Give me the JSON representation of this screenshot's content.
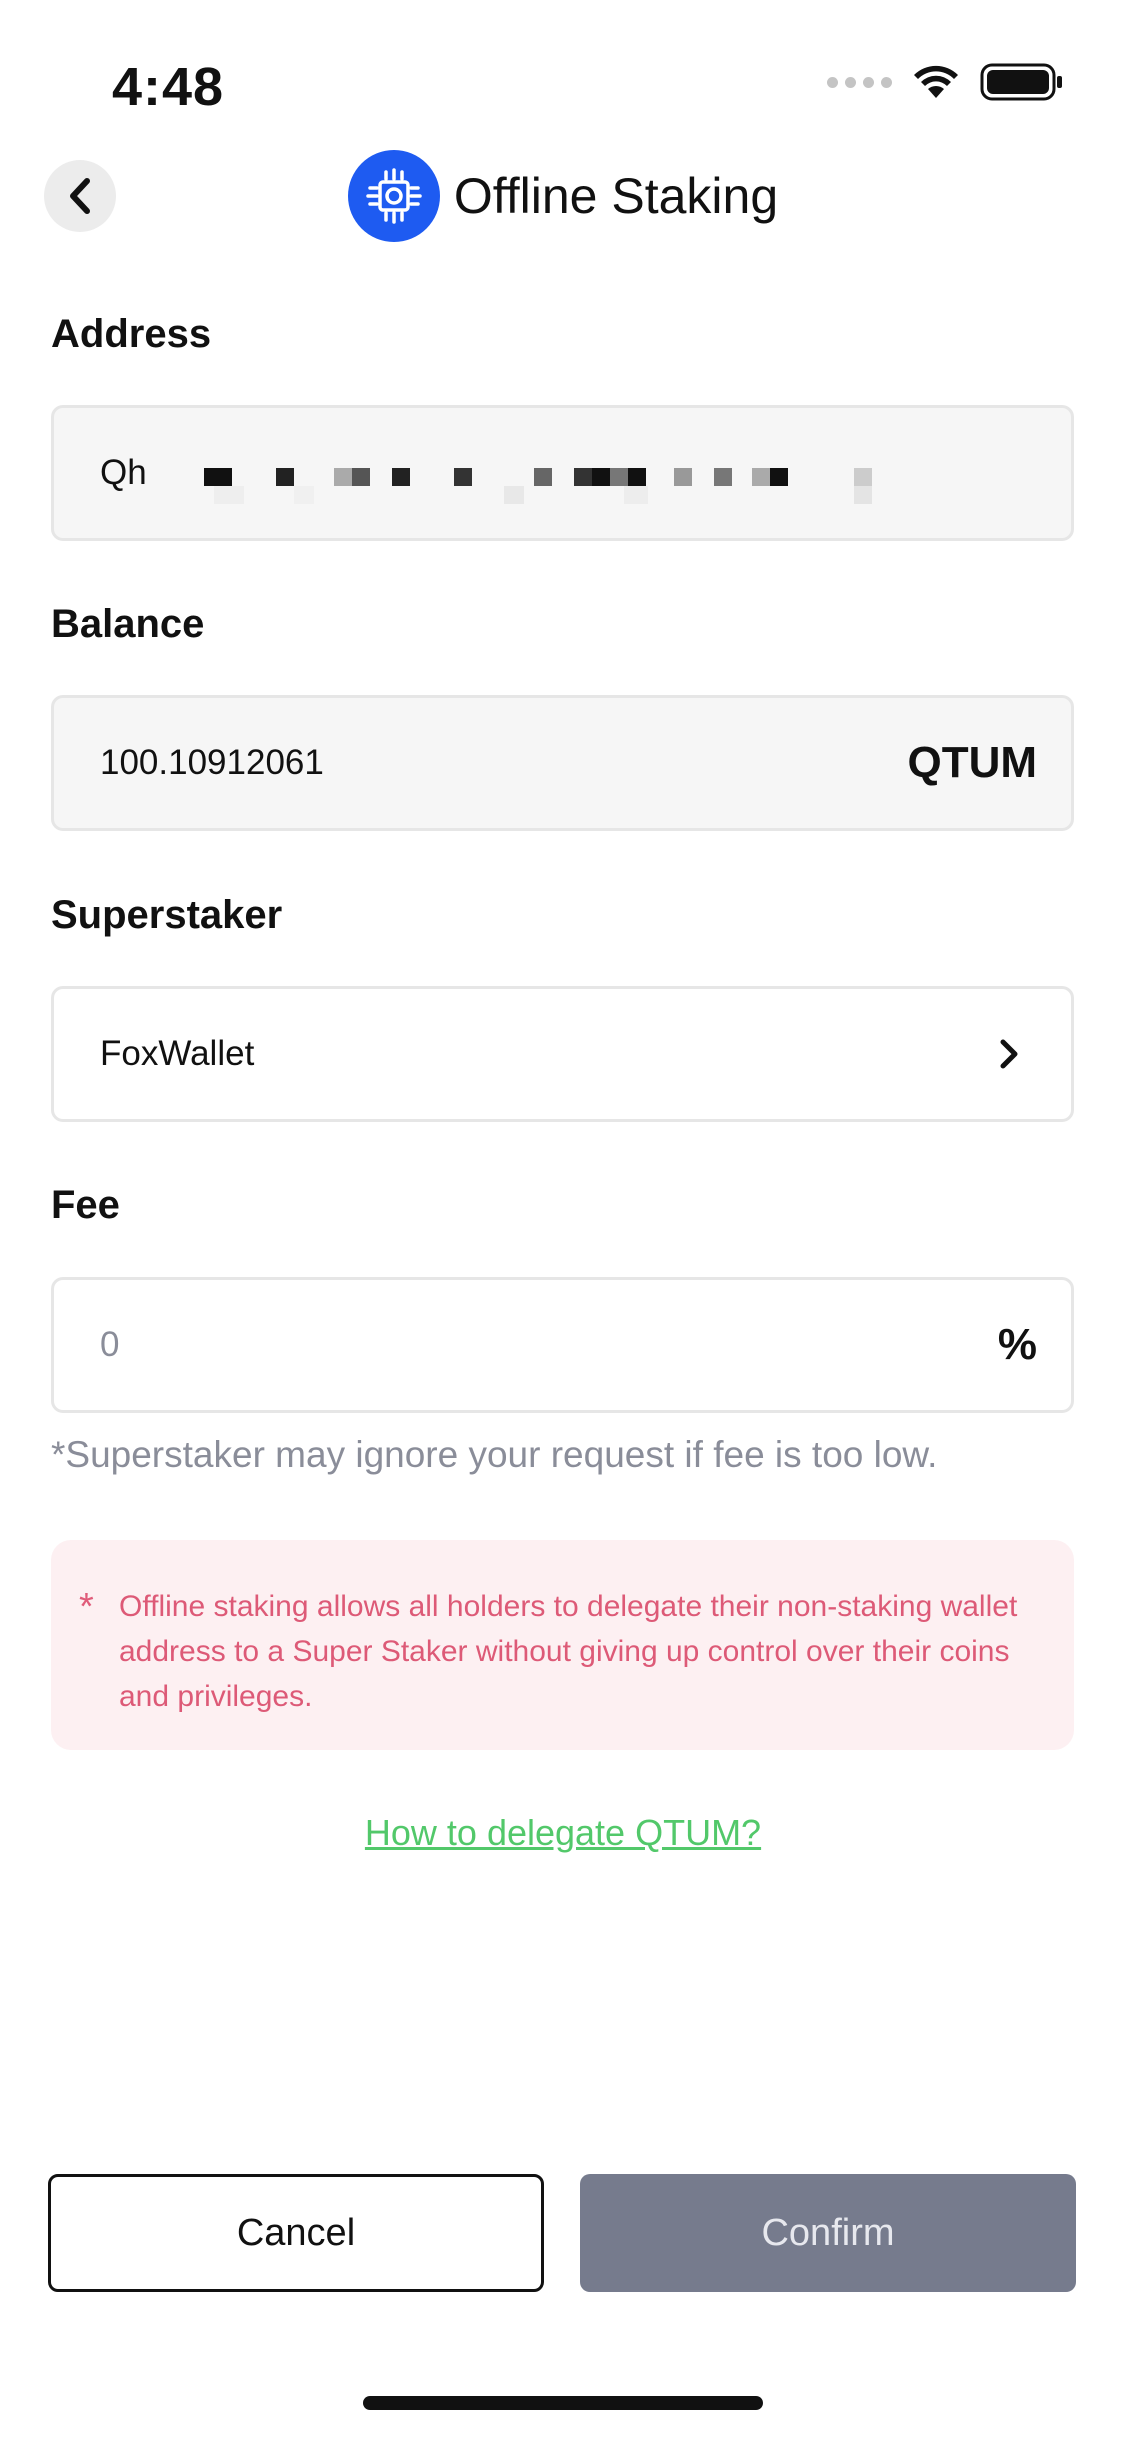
{
  "status_bar": {
    "time": "4:48",
    "icons": [
      "signal-dots-icon",
      "wifi-icon",
      "battery-icon"
    ]
  },
  "header": {
    "back_icon": "chevron-left-icon",
    "logo_icon": "qtum-logo-icon",
    "title": "Offline Staking"
  },
  "form": {
    "address": {
      "label": "Address",
      "value_prefix": "Qh"
    },
    "balance": {
      "label": "Balance",
      "value": "100.10912061",
      "unit": "QTUM"
    },
    "superstaker": {
      "label": "Superstaker",
      "value": "FoxWallet",
      "icon": "chevron-right-icon"
    },
    "fee": {
      "label": "Fee",
      "placeholder": "0",
      "unit": "%"
    },
    "fee_hint": "*Superstaker may ignore your request if fee is too low."
  },
  "notice": {
    "marker": "*",
    "text": "Offline staking allows all holders to delegate their non-staking wallet address to a Super Staker without giving up control over their coins and privileges."
  },
  "help_link": "How to delegate QTUM?",
  "actions": {
    "cancel": "Cancel",
    "confirm": "Confirm"
  },
  "colors": {
    "accent_blue": "#1e5bf1",
    "link_green": "#52c86a",
    "notice_bg": "#fdf0f2",
    "notice_text": "#dd5a77",
    "confirm_disabled": "#767b8d"
  }
}
